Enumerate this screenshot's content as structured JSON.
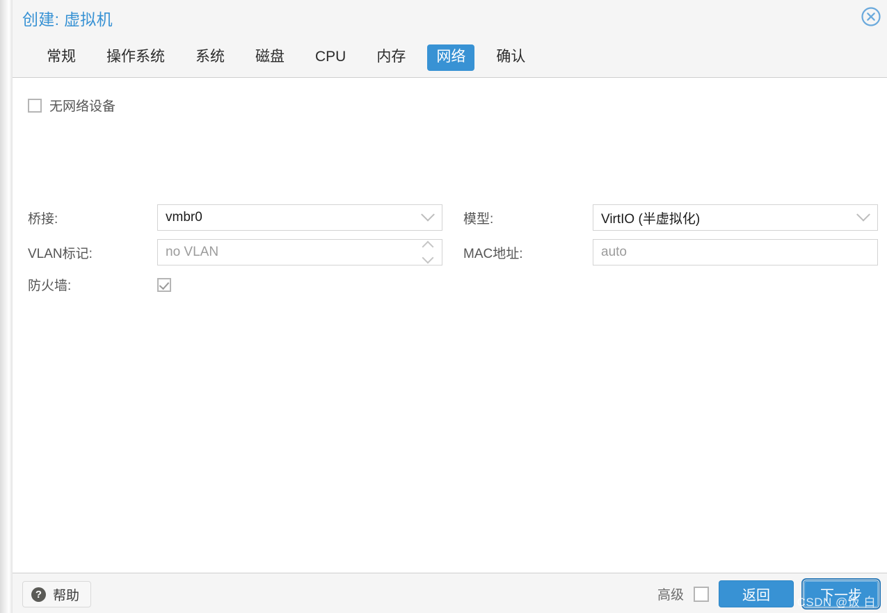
{
  "dialog": {
    "title": "创建: 虚拟机",
    "close_icon": "close-circle-icon"
  },
  "tabs": [
    {
      "label": "常规",
      "active": false
    },
    {
      "label": "操作系统",
      "active": false
    },
    {
      "label": "系统",
      "active": false
    },
    {
      "label": "磁盘",
      "active": false
    },
    {
      "label": "CPU",
      "active": false
    },
    {
      "label": "内存",
      "active": false
    },
    {
      "label": "网络",
      "active": true
    },
    {
      "label": "确认",
      "active": false
    }
  ],
  "form": {
    "no_network_device": {
      "label": "无网络设备",
      "checked": false
    },
    "bridge": {
      "label": "桥接:",
      "value": "vmbr0",
      "icon": "chevron-down-icon"
    },
    "vlan_tag": {
      "label": "VLAN标记:",
      "value": "no VLAN",
      "is_placeholder": true,
      "icon": "spinner-updown-icon"
    },
    "firewall": {
      "label": "防火墙:",
      "checked": true
    },
    "model": {
      "label": "模型:",
      "value": "VirtIO (半虚拟化)",
      "icon": "chevron-down-icon"
    },
    "mac_address": {
      "label": "MAC地址:",
      "value": "auto",
      "is_placeholder": true
    }
  },
  "footer": {
    "help_label": "帮助",
    "help_icon": "question-mark-icon",
    "advanced_label": "高级",
    "advanced_checked": false,
    "back_label": "返回",
    "next_label": "下一步",
    "watermark": "CSDN @饭 白"
  },
  "colors": {
    "accent": "#3892d4",
    "title": "#3892d4",
    "label": "#555555",
    "placeholder": "#9b9b9b",
    "panel": "#f5f5f5",
    "body": "#ffffff"
  }
}
